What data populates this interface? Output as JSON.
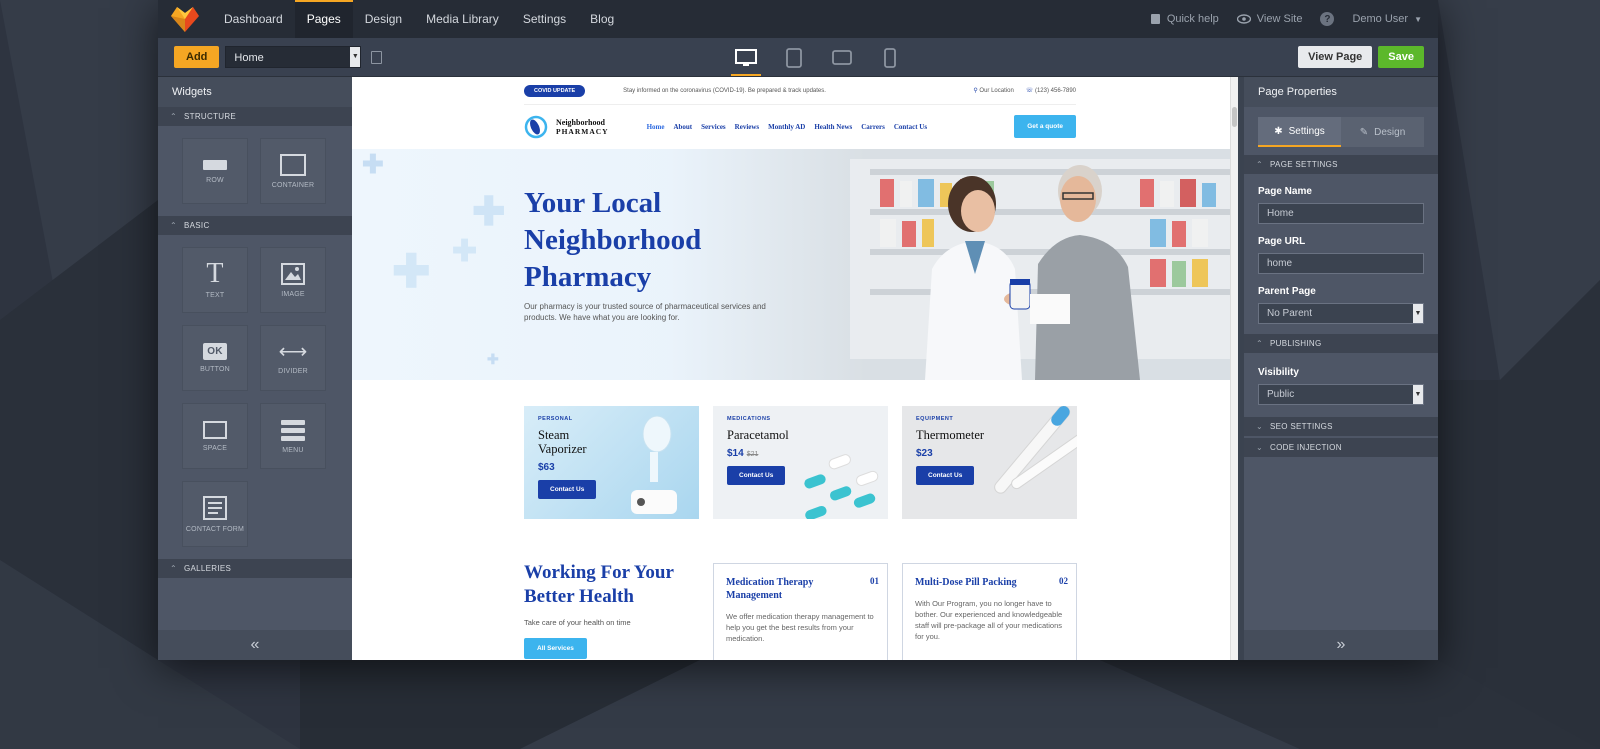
{
  "topnav": {
    "items": [
      "Dashboard",
      "Pages",
      "Design",
      "Media Library",
      "Settings",
      "Blog"
    ],
    "active": "Pages",
    "quick_help": "Quick help",
    "view_site": "View Site",
    "user": "Demo User"
  },
  "toolbar": {
    "add_label": "Add",
    "page_select_value": "Home",
    "view_page_label": "View Page",
    "save_label": "Save",
    "devices": [
      "desktop-icon",
      "tablet-icon",
      "tablet-landscape-icon",
      "mobile-icon"
    ],
    "active_device": "desktop-icon"
  },
  "widgets": {
    "title": "Widgets",
    "sections": {
      "structure": {
        "label": "STRUCTURE",
        "items": [
          "ROW",
          "CONTAINER"
        ]
      },
      "basic": {
        "label": "BASIC",
        "items": [
          "TEXT",
          "IMAGE",
          "BUTTON",
          "DIVIDER",
          "SPACE",
          "MENU",
          "CONTACT FORM"
        ]
      },
      "galleries": {
        "label": "GALLERIES"
      }
    }
  },
  "properties": {
    "title": "Page Properties",
    "tabs": [
      "Settings",
      "Design"
    ],
    "active_tab": "Settings",
    "page_settings": "PAGE SETTINGS",
    "page_name_label": "Page Name",
    "page_name_value": "Home",
    "page_url_label": "Page URL",
    "page_url_value": "home",
    "parent_page_label": "Parent Page",
    "parent_page_value": "No Parent",
    "publishing": "PUBLISHING",
    "visibility_label": "Visibility",
    "visibility_value": "Public",
    "seo_settings": "SEO SETTINGS",
    "code_injection": "CODE INJECTION"
  },
  "site": {
    "covid_badge": "COVID UPDATE",
    "covid_msg": "Stay informed on the coronavirus (COVID-19). Be prepared & track updates.",
    "location": "Our Location",
    "phone": "(123) 456-7890",
    "brand_top": "Neighborhood",
    "brand_bottom": "PHARMACY",
    "nav": [
      "Home",
      "About",
      "Services",
      "Reviews",
      "Monthly AD",
      "Health News",
      "Carrers",
      "Contact Us"
    ],
    "quote_btn": "Get a quote",
    "hero_title": "Your Local Neighborhood Pharmacy",
    "hero_sub": "Our pharmacy is your trusted source of pharmaceutical services and products. We have what you are looking for.",
    "cards": [
      {
        "category": "PERSONAL",
        "name": "Steam Vaporizer",
        "price": "$63",
        "old_price": "",
        "button": "Contact Us",
        "bg": "#bfe1f3"
      },
      {
        "category": "MEDICATIONS",
        "name": "Paracetamol",
        "price": "$14",
        "old_price": "$21",
        "button": "Contact Us",
        "bg": "#eef1f4"
      },
      {
        "category": "EQUIPMENT",
        "name": "Thermometer",
        "price": "$23",
        "button": "Contact Us",
        "old_price": "",
        "bg": "#e6e7e9"
      }
    ],
    "working_title": "Working For Your Better Health",
    "working_sub": "Take care of your health on time",
    "all_services": "All Services",
    "services": [
      {
        "title": "Medication Therapy Management",
        "num": "01",
        "text": "We offer medication therapy management to help you get the best results from your medication."
      },
      {
        "title": "Multi-Dose Pill Packing",
        "num": "02",
        "text": "With Our Program, you no longer have to bother. Our experienced and knowledgeable staff will pre-package all of your medications for you."
      }
    ]
  },
  "colors": {
    "accent": "#f5a623",
    "save": "#5cb82b",
    "brand_blue": "#1a3fa8",
    "sky": "#3cb4ee"
  }
}
